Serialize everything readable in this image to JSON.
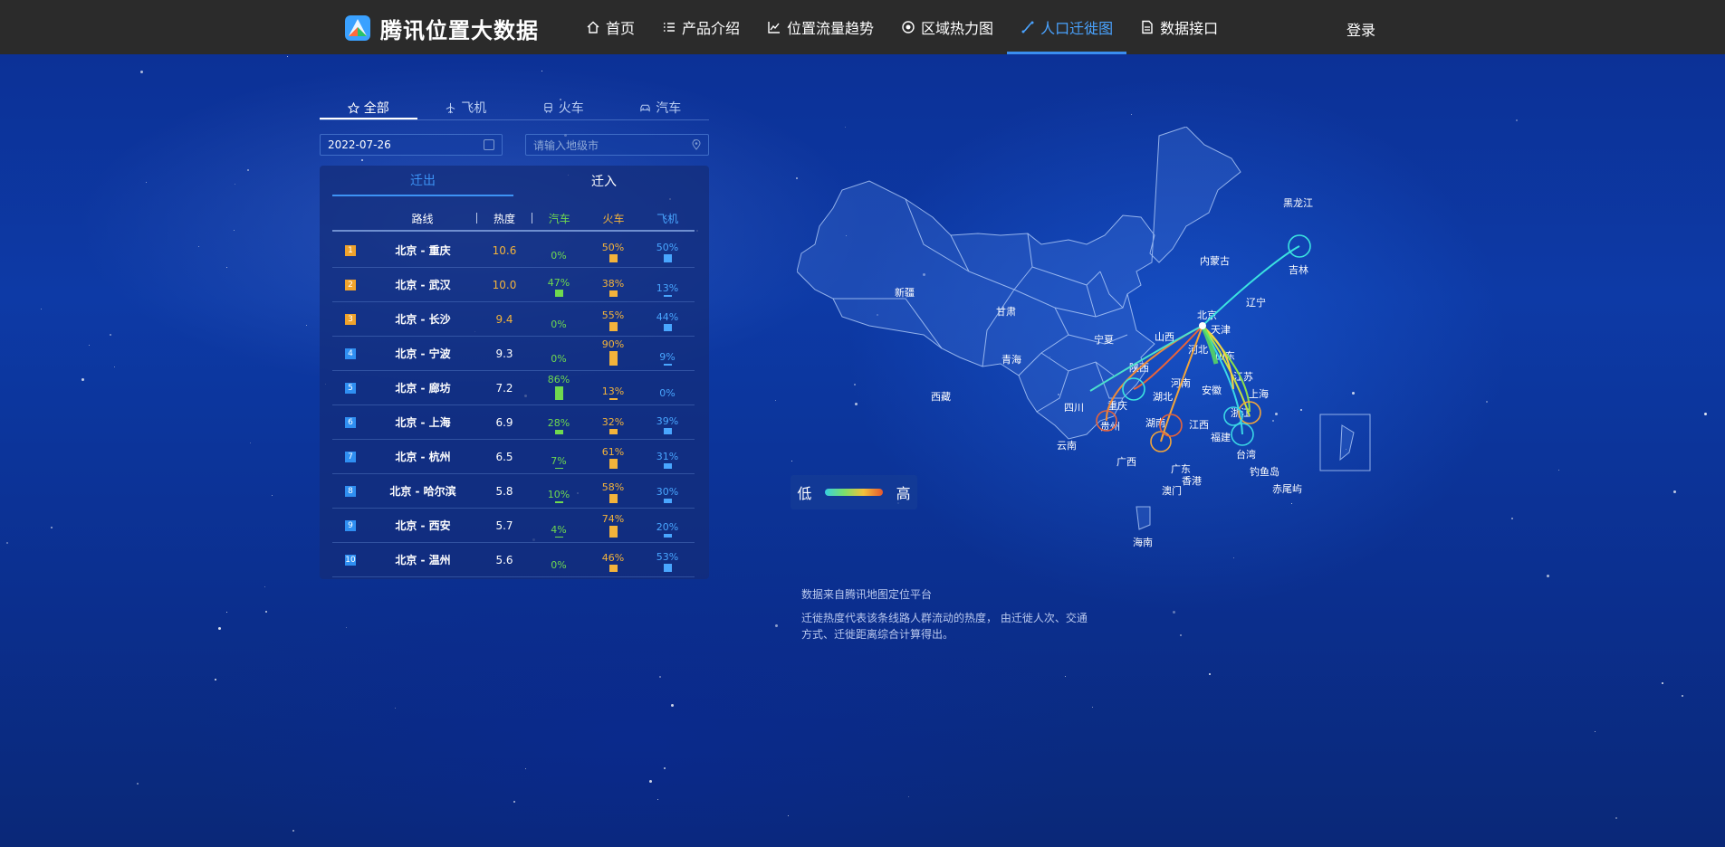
{
  "header": {
    "logo_text": "腾讯位置大数据",
    "nav": [
      {
        "label": "首页",
        "icon": "home-icon"
      },
      {
        "label": "产品介绍",
        "icon": "list-icon"
      },
      {
        "label": "位置流量趋势",
        "icon": "trend-chart-icon"
      },
      {
        "label": "区域热力图",
        "icon": "heat-icon"
      },
      {
        "label": "人口迁徙图",
        "icon": "migration-icon",
        "active": true
      },
      {
        "label": "数据接口",
        "icon": "document-icon"
      }
    ],
    "login": "登录"
  },
  "mode_tabs": [
    {
      "label": "全部",
      "icon": "star-icon",
      "active": true
    },
    {
      "label": "飞机",
      "icon": "plane-icon"
    },
    {
      "label": "火车",
      "icon": "train-icon"
    },
    {
      "label": "汽车",
      "icon": "car-icon"
    }
  ],
  "filters": {
    "date_value": "2022-07-26",
    "city_placeholder": "请输入地级市"
  },
  "direction_tabs": [
    {
      "label": "迁出",
      "active": true
    },
    {
      "label": "迁入"
    }
  ],
  "table": {
    "headers": {
      "route": "路线",
      "heat": "热度",
      "car": "汽车",
      "train": "火车",
      "plane": "飞机"
    },
    "rows": [
      {
        "rank": "1",
        "route": "北京 - 重庆",
        "heat": "10.6",
        "car": "0%",
        "train": "50%",
        "plane": "50%",
        "car_v": 0,
        "train_v": 50,
        "plane_v": 50
      },
      {
        "rank": "2",
        "route": "北京 - 武汉",
        "heat": "10.0",
        "car": "47%",
        "train": "38%",
        "plane": "13%",
        "car_v": 47,
        "train_v": 38,
        "plane_v": 13
      },
      {
        "rank": "3",
        "route": "北京 - 长沙",
        "heat": "9.4",
        "car": "0%",
        "train": "55%",
        "plane": "44%",
        "car_v": 0,
        "train_v": 55,
        "plane_v": 44
      },
      {
        "rank": "4",
        "route": "北京 - 宁波",
        "heat": "9.3",
        "car": "0%",
        "train": "90%",
        "plane": "9%",
        "car_v": 0,
        "train_v": 90,
        "plane_v": 9
      },
      {
        "rank": "5",
        "route": "北京 - 廊坊",
        "heat": "7.2",
        "car": "86%",
        "train": "13%",
        "plane": "0%",
        "car_v": 86,
        "train_v": 13,
        "plane_v": 0
      },
      {
        "rank": "6",
        "route": "北京 - 上海",
        "heat": "6.9",
        "car": "28%",
        "train": "32%",
        "plane": "39%",
        "car_v": 28,
        "train_v": 32,
        "plane_v": 39
      },
      {
        "rank": "7",
        "route": "北京 - 杭州",
        "heat": "6.5",
        "car": "7%",
        "train": "61%",
        "plane": "31%",
        "car_v": 7,
        "train_v": 61,
        "plane_v": 31
      },
      {
        "rank": "8",
        "route": "北京 - 哈尔滨",
        "heat": "5.8",
        "car": "10%",
        "train": "58%",
        "plane": "30%",
        "car_v": 10,
        "train_v": 58,
        "plane_v": 30
      },
      {
        "rank": "9",
        "route": "北京 - 西安",
        "heat": "5.7",
        "car": "4%",
        "train": "74%",
        "plane": "20%",
        "car_v": 4,
        "train_v": 74,
        "plane_v": 20
      },
      {
        "rank": "10",
        "route": "北京 - 温州",
        "heat": "5.6",
        "car": "0%",
        "train": "46%",
        "plane": "53%",
        "car_v": 0,
        "train_v": 46,
        "plane_v": 53
      }
    ]
  },
  "map": {
    "provinces": [
      "黑龙江",
      "吉林",
      "辽宁",
      "内蒙古",
      "新疆",
      "甘肃",
      "宁夏",
      "山西",
      "河北",
      "北京",
      "天津",
      "陕西",
      "青海",
      "西藏",
      "四川",
      "重庆",
      "湖北",
      "河南",
      "山东",
      "安徽",
      "江苏",
      "浙江",
      "上海",
      "湖南",
      "江西",
      "福建",
      "贵州",
      "云南",
      "广西",
      "广东",
      "香港",
      "澳门",
      "海南",
      "台湾",
      "钓鱼岛",
      "赤尾屿"
    ],
    "legend_low": "低",
    "legend_high": "高"
  },
  "notes": {
    "source": "数据来自腾讯地图定位平台",
    "explain": "迁徙热度代表该条线路人群流动的热度， 由迁徙人次、交通方式、迁徙距离综合计算得出。"
  },
  "colors": {
    "car": "#6fd94f",
    "train": "#f3b33b",
    "plane": "#49a6ff",
    "rank_top": "#f0a32c",
    "rank_other": "#2f8ff2",
    "active_nav": "#4aa3ff"
  }
}
